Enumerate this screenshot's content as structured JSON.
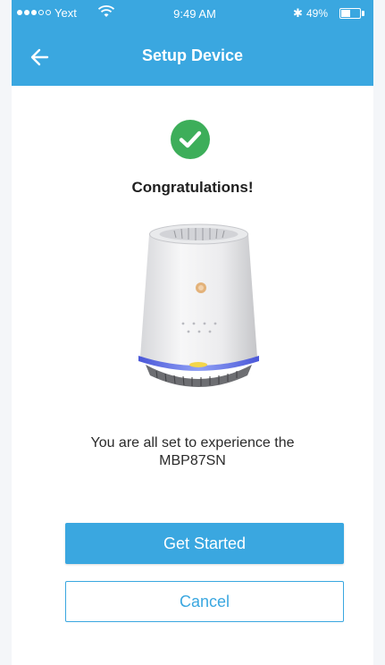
{
  "status_bar": {
    "carrier": "Yext",
    "time": "9:49 AM",
    "battery_percent_text": "49%",
    "battery_level": 0.49,
    "signal_dots_filled": 3,
    "signal_dots_total": 5,
    "bluetooth_glyph": "✱"
  },
  "nav": {
    "title": "Setup Device",
    "back_icon": "arrow-left-icon"
  },
  "content": {
    "success_icon": "check-circle-icon",
    "heading": "Congratulations!",
    "message_line1": "You are all set to experience the",
    "message_line2": "MBP87SN"
  },
  "actions": {
    "primary_label": "Get Started",
    "secondary_label": "Cancel"
  },
  "colors": {
    "accent": "#3aa7e0",
    "success": "#3dae5a"
  }
}
